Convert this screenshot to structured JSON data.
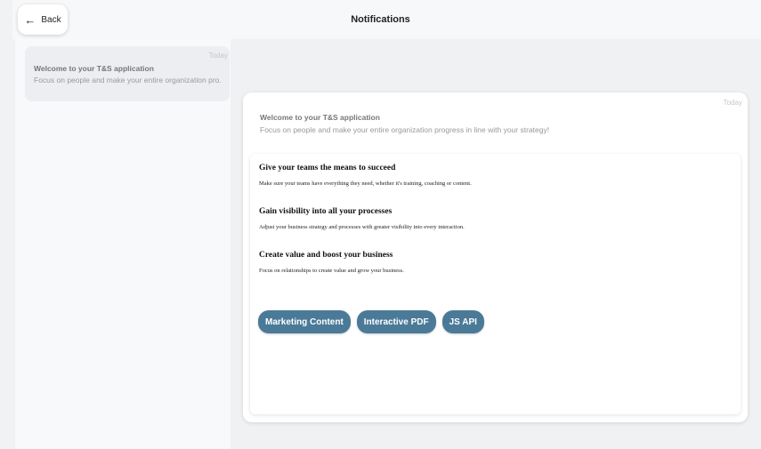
{
  "header": {
    "back_label": "Back",
    "back_icon": "arrow-left-icon",
    "title": "Notifications"
  },
  "sidebar": {
    "items": [
      {
        "date": "Today",
        "title": "Welcome to your T&S application",
        "subtitle": "Focus on people and make your entire organization pro..."
      }
    ]
  },
  "detail": {
    "date": "Today",
    "title": "Welcome to your T&S application",
    "subtitle": "Focus on people and make your entire organization progress in line with your strategy!",
    "sections": [
      {
        "heading": "Give your teams the means to succeed",
        "text": "Make sure your teams have everything they need, whether it's training, coaching or content."
      },
      {
        "heading": "Gain visibility into all your processes",
        "text": "Adjust your business strategy and processes with greater visibility into every interaction."
      },
      {
        "heading": "Create value and boost your business",
        "text": "Focus on relationships to create value and grow your business."
      }
    ],
    "buttons": [
      "Marketing Content",
      "Interactive PDF",
      "JS API"
    ]
  },
  "colors": {
    "accent": "#4a7a98",
    "background": "#f0f1f3",
    "card": "#ffffff"
  }
}
